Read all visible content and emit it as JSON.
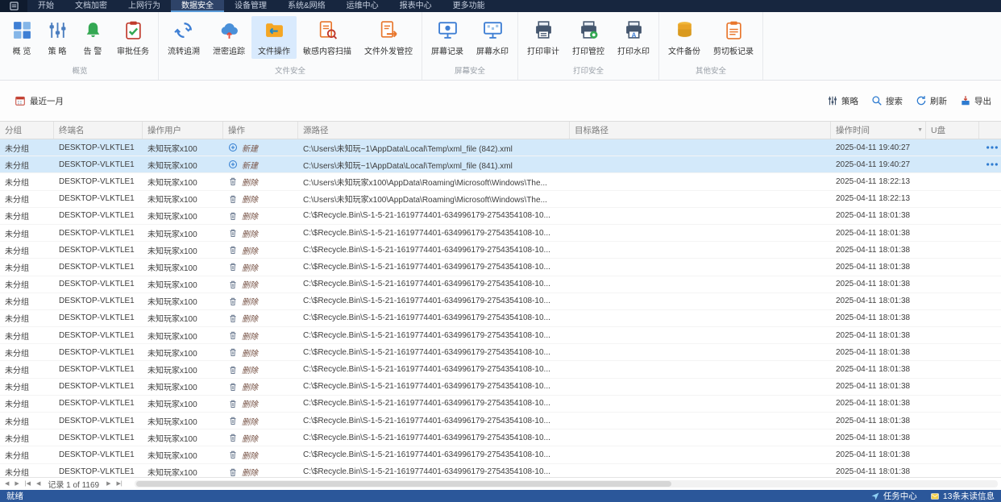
{
  "menu": {
    "items": [
      {
        "label": "开始",
        "active": false
      },
      {
        "label": "文档加密",
        "active": false
      },
      {
        "label": "上网行为",
        "active": false
      },
      {
        "label": "数据安全",
        "active": true
      },
      {
        "label": "设备管理",
        "active": false
      },
      {
        "label": "系统&网络",
        "active": false
      },
      {
        "label": "运维中心",
        "active": false
      },
      {
        "label": "报表中心",
        "active": false
      },
      {
        "label": "更多功能",
        "active": false
      }
    ]
  },
  "ribbon": {
    "groups": [
      {
        "label": "概览",
        "items": [
          {
            "label": "概 览",
            "icon": "grid",
            "active": false
          },
          {
            "label": "策 略",
            "icon": "sliders",
            "active": false
          },
          {
            "label": "告 警",
            "icon": "bell",
            "active": false
          },
          {
            "label": "审批任务",
            "icon": "clipboard-check",
            "active": false
          }
        ]
      },
      {
        "label": "文件安全",
        "items": [
          {
            "label": "流转追溯",
            "icon": "cycle",
            "active": false
          },
          {
            "label": "泄密追踪",
            "icon": "cloud-leak",
            "active": false
          },
          {
            "label": "文件操作",
            "icon": "folder-op",
            "active": true
          },
          {
            "label": "敏感内容扫描",
            "icon": "doc-scan",
            "active": false
          },
          {
            "label": "文件外发管控",
            "icon": "doc-send",
            "active": false
          }
        ]
      },
      {
        "label": "屏幕安全",
        "items": [
          {
            "label": "屏幕记录",
            "icon": "screen-record",
            "active": false
          },
          {
            "label": "屏幕水印",
            "icon": "screen-watermark",
            "active": false
          }
        ]
      },
      {
        "label": "打印安全",
        "items": [
          {
            "label": "打印审计",
            "icon": "print-audit",
            "active": false
          },
          {
            "label": "打印管控",
            "icon": "print-control",
            "active": false
          },
          {
            "label": "打印水印",
            "icon": "print-watermark",
            "active": false
          }
        ]
      },
      {
        "label": "其他安全",
        "items": [
          {
            "label": "文件备份",
            "icon": "file-backup",
            "active": false
          },
          {
            "label": "剪切板记录",
            "icon": "clipboard-record",
            "active": false
          }
        ]
      }
    ]
  },
  "filter_bar": {
    "date_filter": "最近一月",
    "actions": [
      {
        "label": "策略",
        "icon": "policy"
      },
      {
        "label": "搜索",
        "icon": "search"
      },
      {
        "label": "刷新",
        "icon": "refresh"
      },
      {
        "label": "导出",
        "icon": "export"
      }
    ]
  },
  "table": {
    "columns": [
      {
        "label": "分组",
        "filter": false
      },
      {
        "label": "终端名",
        "filter": false
      },
      {
        "label": "操作用户",
        "filter": false
      },
      {
        "label": "操作",
        "filter": false
      },
      {
        "label": "源路径",
        "filter": false
      },
      {
        "label": "目标路径",
        "filter": false
      },
      {
        "label": "操作时间",
        "filter": true
      },
      {
        "label": "U盘",
        "filter": false
      }
    ],
    "rows": [
      {
        "group": "未分组",
        "terminal": "DESKTOP-VLKTLE1",
        "user": "未知玩家x100",
        "action": "新建",
        "action_icon": "circle-plus",
        "source": "C:\\Users\\未知玩~1\\AppData\\Local\\Temp\\xml_file (842).xml",
        "target": "",
        "time": "2025-04-11 19:40:27",
        "usb": "",
        "selected": true,
        "menu": true
      },
      {
        "group": "未分组",
        "terminal": "DESKTOP-VLKTLE1",
        "user": "未知玩家x100",
        "action": "新建",
        "action_icon": "circle-plus",
        "source": "C:\\Users\\未知玩~1\\AppData\\Local\\Temp\\xml_file (841).xml",
        "target": "",
        "time": "2025-04-11 19:40:27",
        "usb": "",
        "selected": true,
        "menu": true
      },
      {
        "group": "未分组",
        "terminal": "DESKTOP-VLKTLE1",
        "user": "未知玩家x100",
        "action": "删除",
        "action_icon": "trash",
        "source": "C:\\Users\\未知玩家x100\\AppData\\Roaming\\Microsoft\\Windows\\The...",
        "target": "",
        "time": "2025-04-11 18:22:13",
        "usb": "",
        "selected": false,
        "menu": false
      },
      {
        "group": "未分组",
        "terminal": "DESKTOP-VLKTLE1",
        "user": "未知玩家x100",
        "action": "删除",
        "action_icon": "trash",
        "source": "C:\\Users\\未知玩家x100\\AppData\\Roaming\\Microsoft\\Windows\\The...",
        "target": "",
        "time": "2025-04-11 18:22:13",
        "usb": "",
        "selected": false,
        "menu": false
      },
      {
        "group": "未分组",
        "terminal": "DESKTOP-VLKTLE1",
        "user": "未知玩家x100",
        "action": "删除",
        "action_icon": "trash",
        "source": "C:\\$Recycle.Bin\\S-1-5-21-1619774401-634996179-2754354108-10...",
        "target": "",
        "time": "2025-04-11 18:01:38",
        "usb": "",
        "selected": false,
        "menu": false
      },
      {
        "group": "未分组",
        "terminal": "DESKTOP-VLKTLE1",
        "user": "未知玩家x100",
        "action": "删除",
        "action_icon": "trash",
        "source": "C:\\$Recycle.Bin\\S-1-5-21-1619774401-634996179-2754354108-10...",
        "target": "",
        "time": "2025-04-11 18:01:38",
        "usb": "",
        "selected": false,
        "menu": false
      },
      {
        "group": "未分组",
        "terminal": "DESKTOP-VLKTLE1",
        "user": "未知玩家x100",
        "action": "删除",
        "action_icon": "trash",
        "source": "C:\\$Recycle.Bin\\S-1-5-21-1619774401-634996179-2754354108-10...",
        "target": "",
        "time": "2025-04-11 18:01:38",
        "usb": "",
        "selected": false,
        "menu": false
      },
      {
        "group": "未分组",
        "terminal": "DESKTOP-VLKTLE1",
        "user": "未知玩家x100",
        "action": "删除",
        "action_icon": "trash",
        "source": "C:\\$Recycle.Bin\\S-1-5-21-1619774401-634996179-2754354108-10...",
        "target": "",
        "time": "2025-04-11 18:01:38",
        "usb": "",
        "selected": false,
        "menu": false
      },
      {
        "group": "未分组",
        "terminal": "DESKTOP-VLKTLE1",
        "user": "未知玩家x100",
        "action": "删除",
        "action_icon": "trash",
        "source": "C:\\$Recycle.Bin\\S-1-5-21-1619774401-634996179-2754354108-10...",
        "target": "",
        "time": "2025-04-11 18:01:38",
        "usb": "",
        "selected": false,
        "menu": false
      },
      {
        "group": "未分组",
        "terminal": "DESKTOP-VLKTLE1",
        "user": "未知玩家x100",
        "action": "删除",
        "action_icon": "trash",
        "source": "C:\\$Recycle.Bin\\S-1-5-21-1619774401-634996179-2754354108-10...",
        "target": "",
        "time": "2025-04-11 18:01:38",
        "usb": "",
        "selected": false,
        "menu": false
      },
      {
        "group": "未分组",
        "terminal": "DESKTOP-VLKTLE1",
        "user": "未知玩家x100",
        "action": "删除",
        "action_icon": "trash",
        "source": "C:\\$Recycle.Bin\\S-1-5-21-1619774401-634996179-2754354108-10...",
        "target": "",
        "time": "2025-04-11 18:01:38",
        "usb": "",
        "selected": false,
        "menu": false
      },
      {
        "group": "未分组",
        "terminal": "DESKTOP-VLKTLE1",
        "user": "未知玩家x100",
        "action": "删除",
        "action_icon": "trash",
        "source": "C:\\$Recycle.Bin\\S-1-5-21-1619774401-634996179-2754354108-10...",
        "target": "",
        "time": "2025-04-11 18:01:38",
        "usb": "",
        "selected": false,
        "menu": false
      },
      {
        "group": "未分组",
        "terminal": "DESKTOP-VLKTLE1",
        "user": "未知玩家x100",
        "action": "删除",
        "action_icon": "trash",
        "source": "C:\\$Recycle.Bin\\S-1-5-21-1619774401-634996179-2754354108-10...",
        "target": "",
        "time": "2025-04-11 18:01:38",
        "usb": "",
        "selected": false,
        "menu": false
      },
      {
        "group": "未分组",
        "terminal": "DESKTOP-VLKTLE1",
        "user": "未知玩家x100",
        "action": "删除",
        "action_icon": "trash",
        "source": "C:\\$Recycle.Bin\\S-1-5-21-1619774401-634996179-2754354108-10...",
        "target": "",
        "time": "2025-04-11 18:01:38",
        "usb": "",
        "selected": false,
        "menu": false
      },
      {
        "group": "未分组",
        "terminal": "DESKTOP-VLKTLE1",
        "user": "未知玩家x100",
        "action": "删除",
        "action_icon": "trash",
        "source": "C:\\$Recycle.Bin\\S-1-5-21-1619774401-634996179-2754354108-10...",
        "target": "",
        "time": "2025-04-11 18:01:38",
        "usb": "",
        "selected": false,
        "menu": false
      },
      {
        "group": "未分组",
        "terminal": "DESKTOP-VLKTLE1",
        "user": "未知玩家x100",
        "action": "删除",
        "action_icon": "trash",
        "source": "C:\\$Recycle.Bin\\S-1-5-21-1619774401-634996179-2754354108-10...",
        "target": "",
        "time": "2025-04-11 18:01:38",
        "usb": "",
        "selected": false,
        "menu": false
      },
      {
        "group": "未分组",
        "terminal": "DESKTOP-VLKTLE1",
        "user": "未知玩家x100",
        "action": "删除",
        "action_icon": "trash",
        "source": "C:\\$Recycle.Bin\\S-1-5-21-1619774401-634996179-2754354108-10...",
        "target": "",
        "time": "2025-04-11 18:01:38",
        "usb": "",
        "selected": false,
        "menu": false
      },
      {
        "group": "未分组",
        "terminal": "DESKTOP-VLKTLE1",
        "user": "未知玩家x100",
        "action": "删除",
        "action_icon": "trash",
        "source": "C:\\$Recycle.Bin\\S-1-5-21-1619774401-634996179-2754354108-10...",
        "target": "",
        "time": "2025-04-11 18:01:38",
        "usb": "",
        "selected": false,
        "menu": false
      },
      {
        "group": "未分组",
        "terminal": "DESKTOP-VLKTLE1",
        "user": "未知玩家x100",
        "action": "删除",
        "action_icon": "trash",
        "source": "C:\\$Recycle.Bin\\S-1-5-21-1619774401-634996179-2754354108-10...",
        "target": "",
        "time": "2025-04-11 18:01:38",
        "usb": "",
        "selected": false,
        "menu": false
      },
      {
        "group": "未分组",
        "terminal": "DESKTOP-VLKTLE1",
        "user": "未知玩家x100",
        "action": "删除",
        "action_icon": "trash",
        "source": "C:\\$Recycle.Bin\\S-1-5-21-1619774401-634996179-2754354108-10...",
        "target": "",
        "time": "2025-04-11 18:01:38",
        "usb": "",
        "selected": false,
        "menu": false
      }
    ]
  },
  "pagination": {
    "record_text": "记录 1 of 1169"
  },
  "status_bar": {
    "left": "就绪",
    "task_center": "任务中心",
    "unread": "13条未读信息"
  }
}
